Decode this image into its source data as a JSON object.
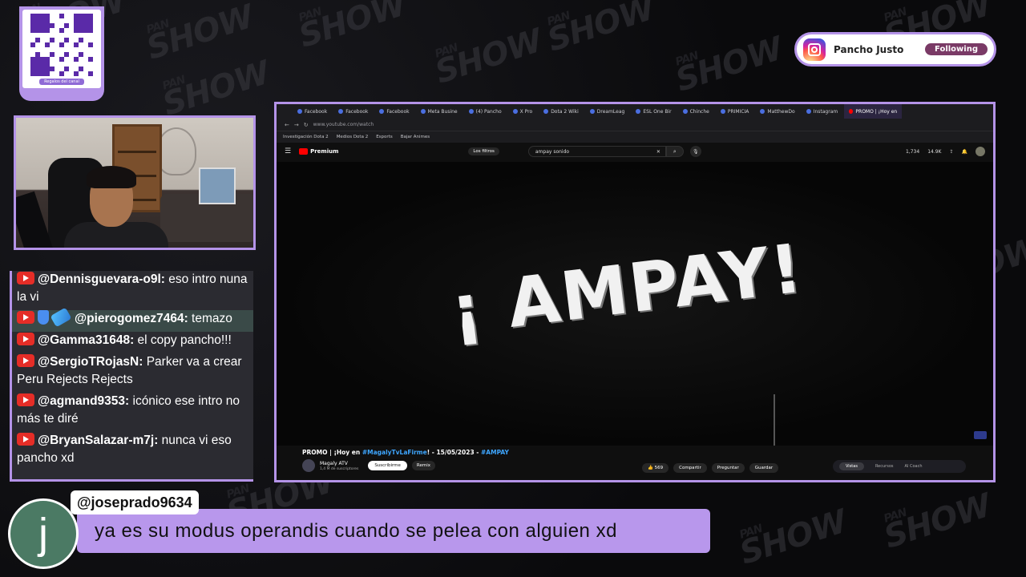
{
  "watermark": {
    "small": "PAN",
    "big": "SHOW"
  },
  "qr": {
    "caption": "Regalos del canal"
  },
  "chat": {
    "messages": [
      {
        "user": "@Dennisguevara-o9l:",
        "text": " eso intro nuna la vi"
      },
      {
        "user": "@pierogomez7464:",
        "text": " temazo"
      },
      {
        "user": "@Gamma31648:",
        "text": " el copy pancho!!!"
      },
      {
        "user": "@SergioTRojasN:",
        "text": " Parker va a crear Peru Rejects Rejects"
      },
      {
        "user": "@agmand9353:",
        "text": " icónico ese intro no más te diré"
      },
      {
        "user": "@BryanSalazar-m7j:",
        "text": " nunca vi eso pancho xd"
      }
    ]
  },
  "instagram": {
    "name": "Pancho Justo",
    "button": "Following"
  },
  "browser": {
    "tabs": [
      "Facebook",
      "Facebook",
      "Facebook",
      "Meta Busine",
      "(4) Pancho",
      "X Pro",
      "Dota 2 Wiki",
      "DreamLeag",
      "ESL One Bir",
      "Chinche",
      "PRIMICIA",
      "MatthewDo",
      "Instagram",
      "PROMO | ¡Hoy en"
    ],
    "url": "www.youtube.com/watch",
    "bookmarks": [
      "Investigación Dota 2",
      "Medios Dota 2",
      "Esports",
      "Bajar Animes"
    ],
    "yt": {
      "logo": "Premium",
      "filters": "Los filtros",
      "search": "ampay sonido",
      "stats1": "1,734",
      "stats2": "14.9K"
    },
    "video": {
      "overlay_text": "¡ AMPAY!",
      "title_prefix": "PROMO | ¡Hoy en ",
      "title_tag1": "#MagalyTvLaFirme",
      "title_mid": "! - 15/05/2023 - ",
      "title_tag2": "#AMPAY",
      "channel": "Magaly ATV",
      "subs": "1,4 M de suscriptores",
      "subscribe": "Suscribirme",
      "remix": "Remix",
      "likes": "569",
      "share": "Compartir",
      "ask": "Preguntar",
      "save": "Guardar",
      "panel_tabs": [
        "Vistas",
        "Recursos",
        "AI Coach"
      ]
    }
  },
  "highlight": {
    "avatar_letter": "j",
    "user": "@joseprado9634",
    "text": "ya es su modus operandis cuando se pelea con alguien xd"
  }
}
